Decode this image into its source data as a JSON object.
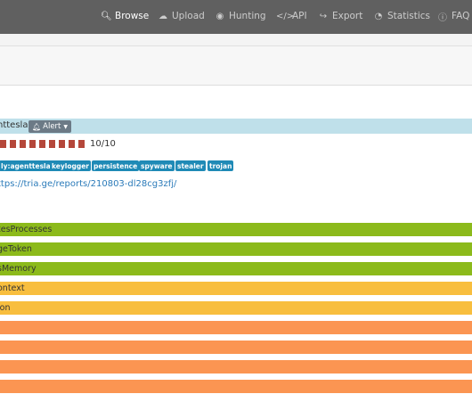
{
  "nav": {
    "items": [
      {
        "label": "Browse",
        "icon": "search-icon",
        "active": true
      },
      {
        "label": "Upload",
        "icon": "cloud-upload-icon",
        "active": false
      },
      {
        "label": "Hunting",
        "icon": "binoculars-icon",
        "active": false
      },
      {
        "label": "API",
        "icon": "code-icon",
        "active": false
      },
      {
        "label": "Export",
        "icon": "export-icon",
        "active": false
      },
      {
        "label": "Statistics",
        "icon": "pie-chart-icon",
        "active": false
      },
      {
        "label": "FAQ",
        "icon": "question-icon",
        "active": false
      }
    ]
  },
  "malware": {
    "family": "nttesla",
    "alert_label": "Alert",
    "score_text": "10/10",
    "score_value": 10,
    "score_max": 10,
    "tags": [
      "ly:agenttesla",
      "keylogger",
      "persistence",
      "spyware",
      "stealer",
      "trojan"
    ],
    "report_url": "ttps://tria.ge/reports/210803-dl28cg3zfj/"
  },
  "signatures": [
    {
      "label": "tesProcesses",
      "color": "#8cba1b"
    },
    {
      "label": "geToken",
      "color": "#8cba1b"
    },
    {
      "label": "sMemory",
      "color": "#8cba1b"
    },
    {
      "label": "ontext",
      "color": "#f8be3e"
    },
    {
      "label": "ion",
      "color": "#f8be3e"
    },
    {
      "label": "",
      "color": "#fb9552"
    },
    {
      "label": "",
      "color": "#fb9552"
    },
    {
      "label": "",
      "color": "#fb9552"
    },
    {
      "label": "",
      "color": "#fb9552"
    }
  ],
  "colors": {
    "navbar": "#606060",
    "family_bar": "#bfe0ea",
    "score_box": "#b5473a",
    "tag": "#1f8ab6",
    "link": "#2a7ab9"
  }
}
